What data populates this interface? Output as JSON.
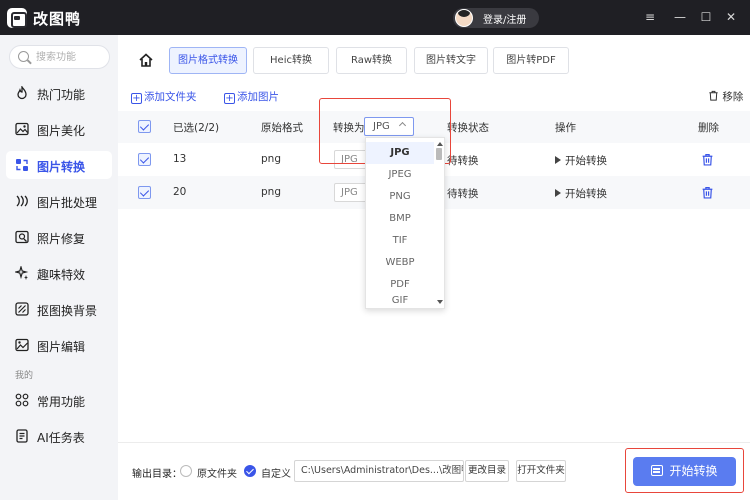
{
  "app": {
    "title": "改图鸭",
    "login_label": "登录/注册"
  },
  "window_controls": [
    "≡",
    "—",
    "☐",
    "✕"
  ],
  "sidebar": {
    "search_placeholder": "搜索功能",
    "items": [
      {
        "label": "热门功能",
        "icon": "flame-icon"
      },
      {
        "label": "图片美化",
        "icon": "image-icon"
      },
      {
        "label": "图片转换",
        "icon": "convert-icon",
        "active": true
      },
      {
        "label": "图片批处理",
        "icon": "batch-icon"
      },
      {
        "label": "照片修复",
        "icon": "photo-repair-icon"
      },
      {
        "label": "趣味特效",
        "icon": "sparkle-icon"
      },
      {
        "label": "抠图换背景",
        "icon": "cutout-icon"
      },
      {
        "label": "图片编辑",
        "icon": "edit-image-icon"
      }
    ],
    "section_label": "我的",
    "my_items": [
      {
        "label": "常用功能",
        "icon": "grid-icon"
      },
      {
        "label": "AI任务表",
        "icon": "ai-task-icon"
      }
    ]
  },
  "tabs": [
    {
      "label": "图片格式转换",
      "active": true
    },
    {
      "label": "Heic转换"
    },
    {
      "label": "Raw转换"
    },
    {
      "label": "图片转文字"
    },
    {
      "label": "图片转PDF"
    }
  ],
  "actions": {
    "add_folder": "添加文件夹",
    "add_image": "添加图片",
    "remove": "移除"
  },
  "table": {
    "headers": {
      "selected": "已选(2/2)",
      "original_format": "原始格式",
      "convert_to": "转换为",
      "status": "转换状态",
      "operation": "操作",
      "delete": "删除"
    },
    "header_select_value": "JPG",
    "rows": [
      {
        "name": "13",
        "format": "png",
        "target": "JPG",
        "status": "待转换",
        "operation": "开始转换"
      },
      {
        "name": "20",
        "format": "png",
        "target": "JPG",
        "status": "待转换",
        "operation": "开始转换"
      }
    ]
  },
  "format_dropdown": {
    "options": [
      "JPG",
      "JPEG",
      "PNG",
      "BMP",
      "TIF",
      "WEBP",
      "PDF",
      "GIF"
    ],
    "selected": "JPG"
  },
  "bottom": {
    "output_label": "输出目录：",
    "option_original": "原文件夹",
    "option_custom": "自定义",
    "path": "C:\\Users\\Administrator\\Des...\\改图鸭",
    "change_dir": "更改目录",
    "open_folder": "打开文件夹",
    "start_all": "开始转换"
  },
  "colors": {
    "accent": "#3a55e8",
    "button": "#5a7cf0",
    "highlight": "#e8463b",
    "titlebar": "#1f1f24"
  }
}
